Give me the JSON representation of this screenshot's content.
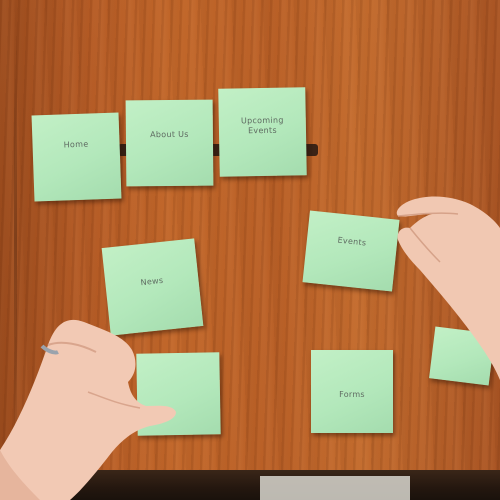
{
  "scene": {
    "surface": "wooden table",
    "note_color": "#b6eabd",
    "wood_color": "#b75c25"
  },
  "notes": [
    {
      "id": "note-1",
      "text": "Home"
    },
    {
      "id": "note-2",
      "text": "About Us"
    },
    {
      "id": "note-3",
      "text": "Upcoming Events"
    },
    {
      "id": "note-4",
      "text": "News"
    },
    {
      "id": "note-5",
      "text": "Events"
    },
    {
      "id": "note-6",
      "text": ""
    },
    {
      "id": "note-7",
      "text": "Forms"
    },
    {
      "id": "note-8",
      "text": ""
    }
  ]
}
